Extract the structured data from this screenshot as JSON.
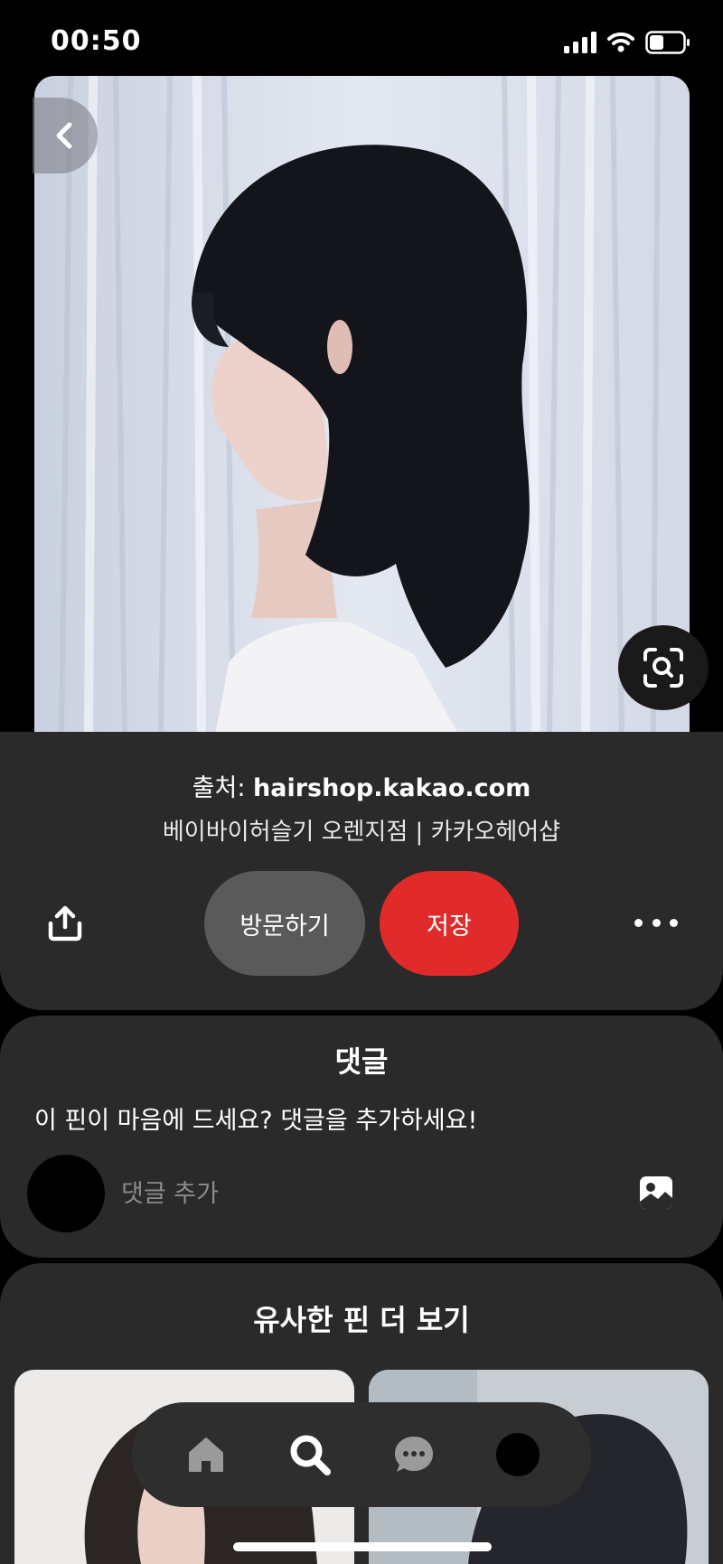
{
  "status_bar": {
    "time": "00:50"
  },
  "pin": {
    "source_prefix": "출처:",
    "source_domain": "hairshop.kakao.com",
    "title": "베이바이허슬기 오렌지점 | 카카오헤어샵",
    "visit_label": "방문하기",
    "save_label": "저장"
  },
  "comments": {
    "heading": "댓글",
    "prompt": "이 핀이 마음에 드세요? 댓글을 추가하세요!",
    "input_placeholder": "댓글 추가"
  },
  "similar": {
    "heading": "유사한 핀 더 보기"
  },
  "icons": {
    "back": "chevron-left-icon",
    "lens": "visual-search-icon",
    "share": "share-icon",
    "more": "more-dots-icon",
    "image": "image-icon",
    "home": "home-icon",
    "search": "search-icon",
    "messages": "chat-icon",
    "profile": "avatar"
  },
  "colors": {
    "save_button": "#e12b2b",
    "card_background": "#2a2a2a"
  }
}
